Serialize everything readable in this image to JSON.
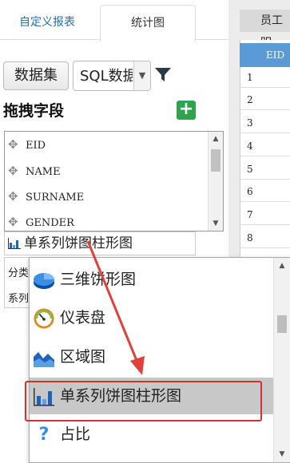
{
  "tabs": [
    {
      "label": "自定义报表",
      "active": false
    },
    {
      "label": "统计图",
      "active": true
    }
  ],
  "toolbar": {
    "dataset_button": "数据集",
    "source_select_value": "SQL数据",
    "filter_icon": "filter-icon"
  },
  "fields_panel": {
    "title": "拖拽字段",
    "add_icon": "plus-icon",
    "fields": [
      "EID",
      "NAME",
      "SURNAME",
      "GENDER"
    ]
  },
  "chart_type_select": {
    "value": "单系列饼图柱形图",
    "icon": "bar-chart-icon"
  },
  "props": {
    "category_label": "分类",
    "series_label": "系列"
  },
  "right_panel": {
    "header": "员工明",
    "column_header": "EID",
    "rows": [
      "1",
      "2",
      "3",
      "4",
      "5",
      "6",
      "7",
      "8"
    ]
  },
  "dropdown": {
    "items": [
      {
        "label": "三维饼形图",
        "icon": "pie-3d-icon",
        "selected": false
      },
      {
        "label": "仪表盘",
        "icon": "gauge-icon",
        "selected": false
      },
      {
        "label": "区域图",
        "icon": "area-chart-icon",
        "selected": false
      },
      {
        "label": "单系列饼图柱形图",
        "icon": "bar-chart-icon",
        "selected": true
      },
      {
        "label": "占比",
        "icon": "question-icon",
        "selected": false
      }
    ]
  },
  "colors": {
    "tab_active_text": "#1f6fb5",
    "add_button": "#2ea44f",
    "grid_header": "#5b9bd5",
    "highlight_box": "#d9302b",
    "selected_item_bg": "#c8c8c8"
  }
}
